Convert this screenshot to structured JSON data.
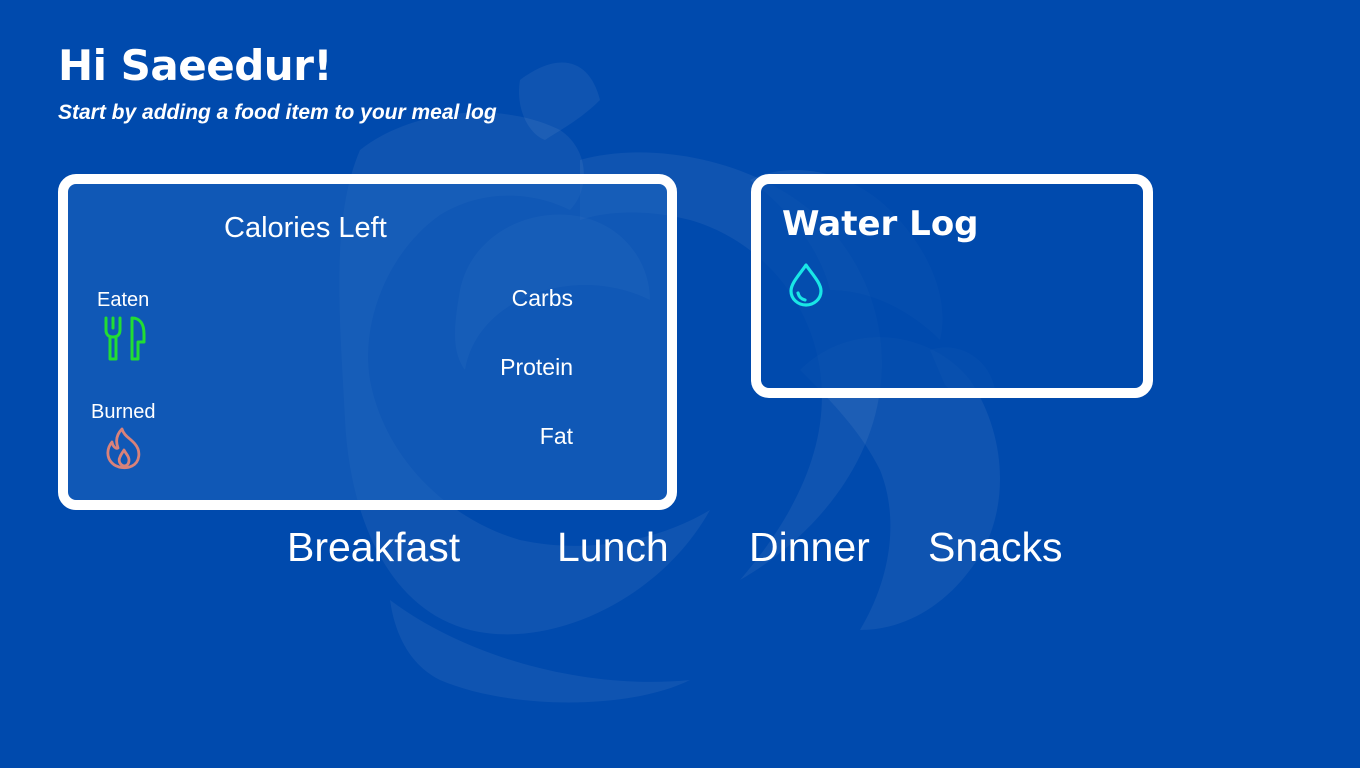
{
  "header": {
    "greeting": "Hi Saeedur!",
    "subtitle": "Start by adding a food item to your meal log"
  },
  "calories_card": {
    "title": "Calories Left",
    "eaten_label": "Eaten",
    "eaten_icon": "fork-knife-icon",
    "burned_label": "Burned",
    "burned_icon": "flame-icon",
    "macros": {
      "carbs": "Carbs",
      "protein": "Protein",
      "fat": "Fat"
    }
  },
  "water_card": {
    "title": "Water Log",
    "icon": "water-drop-icon"
  },
  "meal_tabs": [
    {
      "label": "Breakfast"
    },
    {
      "label": "Lunch"
    },
    {
      "label": "Dinner"
    },
    {
      "label": "Snacks"
    }
  ],
  "colors": {
    "background": "#004aad",
    "eaten_icon": "#22dd33",
    "burned_icon": "#d9827a",
    "water_icon": "#19e6e6",
    "card_border": "#ffffff"
  }
}
